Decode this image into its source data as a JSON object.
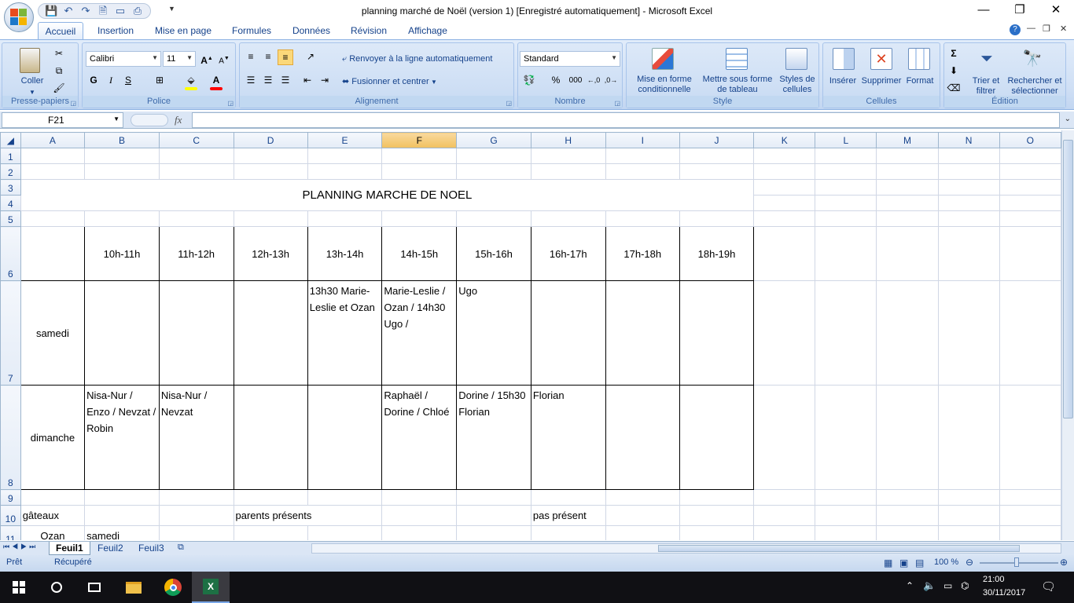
{
  "window": {
    "title": "planning marché de Noël (version 1) [Enregistré automatiquement] - Microsoft Excel",
    "controls": [
      "—",
      "❐",
      "✕"
    ]
  },
  "ribbon_tabs": [
    "Accueil",
    "Insertion",
    "Mise en page",
    "Formules",
    "Données",
    "Révision",
    "Affichage"
  ],
  "ribbon": {
    "clipboard": {
      "paste": "Coller",
      "label": "Presse-papiers"
    },
    "font": {
      "name": "Calibri",
      "size": "11",
      "label": "Police",
      "bold": "G",
      "italic": "I",
      "underline": "S"
    },
    "alignment": {
      "wrap": "Renvoyer à la ligne automatiquement",
      "merge": "Fusionner et centrer",
      "label": "Alignement"
    },
    "number": {
      "format": "Standard",
      "label": "Nombre",
      "percent": "%",
      "thousands": "000"
    },
    "style": {
      "conditional": "Mise en forme conditionnelle",
      "table": "Mettre sous forme de tableau",
      "cell_styles": "Styles de cellules",
      "label": "Style"
    },
    "cells": {
      "insert": "Insérer",
      "delete": "Supprimer",
      "format": "Format",
      "label": "Cellules"
    },
    "editing": {
      "sort": "Trier et filtrer",
      "find": "Rechercher et sélectionner",
      "label": "Édition"
    }
  },
  "formula_bar": {
    "name_box": "F21",
    "fx": "fx",
    "value": ""
  },
  "columns": [
    "A",
    "B",
    "C",
    "D",
    "E",
    "F",
    "G",
    "H",
    "I",
    "J",
    "K",
    "L",
    "M",
    "N",
    "O"
  ],
  "sheet": {
    "title": "PLANNING MARCHE DE NOEL",
    "hours": [
      "10h-11h",
      "11h-12h",
      "12h-13h",
      "13h-14h",
      "14h-15h",
      "15h-16h",
      "16h-17h",
      "17h-18h",
      "18h-19h"
    ],
    "samedi": {
      "label": "samedi",
      "cells": [
        "",
        "",
        "",
        "13h30 Marie-Leslie et Ozan",
        "Marie-Leslie / Ozan / 14h30 Ugo /",
        "Ugo",
        "",
        "",
        ""
      ]
    },
    "dimanche": {
      "label": "dimanche",
      "cells": [
        "Nisa-Nur / Enzo / Nevzat / Robin",
        "Nisa-Nur / Nevzat",
        "",
        "",
        "Raphaël / Dorine / Chloé",
        " Dorine / 15h30 Florian",
        "Florian",
        "",
        ""
      ]
    },
    "row10": {
      "a": "gâteaux",
      "e": "parents présents",
      "h": "pas présent"
    },
    "row11": {
      "a": "Ozan",
      "b": "samedi"
    }
  },
  "sheet_tabs": [
    "Feuil1",
    "Feuil2",
    "Feuil3"
  ],
  "status": {
    "ready": "Prêt",
    "recovered": "Récupéré",
    "zoom": "100 %"
  },
  "taskbar": {
    "time": "21:00",
    "date": "30/11/2017"
  }
}
